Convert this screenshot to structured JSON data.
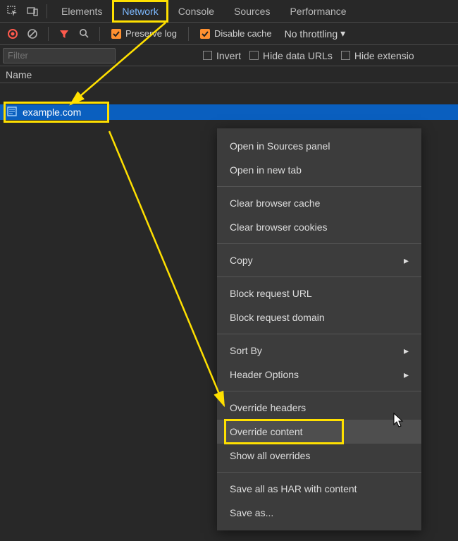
{
  "tabs": {
    "elements": "Elements",
    "network": "Network",
    "console": "Console",
    "sources": "Sources",
    "performance": "Performance"
  },
  "toolbar": {
    "preserve_log": "Preserve log",
    "disable_cache": "Disable cache",
    "throttling": "No throttling"
  },
  "filterbar": {
    "placeholder": "Filter",
    "invert": "Invert",
    "hide_data_urls": "Hide data URLs",
    "hide_extensions": "Hide extensio"
  },
  "table": {
    "name_header": "Name",
    "rows": [
      {
        "name": "example.com"
      }
    ]
  },
  "context_menu": {
    "open_sources": "Open in Sources panel",
    "open_tab": "Open in new tab",
    "clear_cache": "Clear browser cache",
    "clear_cookies": "Clear browser cookies",
    "copy": "Copy",
    "block_url": "Block request URL",
    "block_domain": "Block request domain",
    "sort_by": "Sort By",
    "header_options": "Header Options",
    "override_headers": "Override headers",
    "override_content": "Override content",
    "show_overrides": "Show all overrides",
    "save_har": "Save all as HAR with content",
    "save_as": "Save as..."
  }
}
